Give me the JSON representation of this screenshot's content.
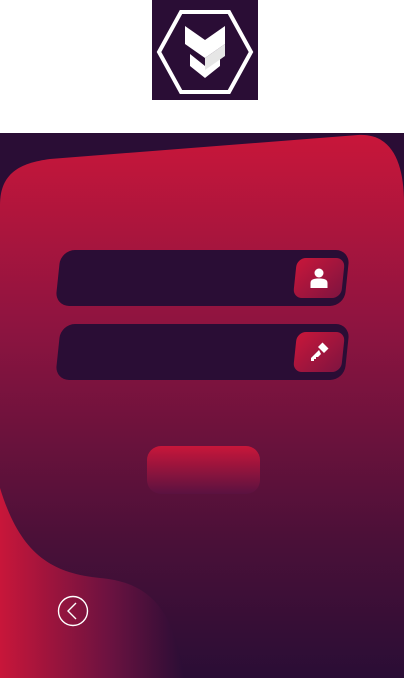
{
  "logo": {
    "icon": "shield-chevron-hexagon-icon"
  },
  "form": {
    "username": {
      "value": "",
      "placeholder": "",
      "icon": "user-icon"
    },
    "password": {
      "value": "",
      "placeholder": "",
      "icon": "key-icon"
    },
    "submit_label": ""
  },
  "back": {
    "icon": "back-arrow-circle-icon"
  },
  "colors": {
    "dark": "#2a0d35",
    "accent": "#c8163a",
    "white": "#ffffff"
  }
}
